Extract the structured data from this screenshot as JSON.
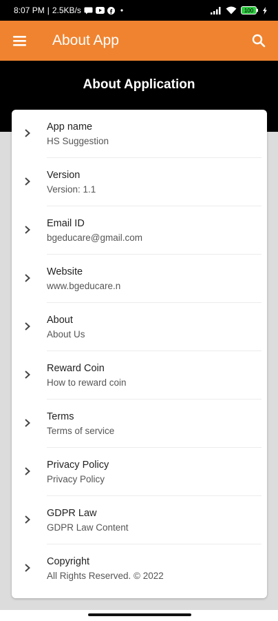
{
  "status_bar": {
    "time": "8:07 PM",
    "separator": "|",
    "speed": "2.5KB/s",
    "battery": "100"
  },
  "app_bar": {
    "title": "About App",
    "menu_icon": "hamburger-menu-icon",
    "search_icon": "search-icon"
  },
  "section": {
    "title": "About Application"
  },
  "items": [
    {
      "title": "App name",
      "subtitle": "HS Suggestion"
    },
    {
      "title": "Version",
      "subtitle": "Version: 1.1"
    },
    {
      "title": "Email ID",
      "subtitle": "bgeducare@gmail.com"
    },
    {
      "title": "Website",
      "subtitle": "www.bgeducare.n"
    },
    {
      "title": "About",
      "subtitle": "About Us"
    },
    {
      "title": "Reward Coin",
      "subtitle": "How to reward coin"
    },
    {
      "title": "Terms",
      "subtitle": "Terms of service"
    },
    {
      "title": "Privacy Policy",
      "subtitle": "Privacy Policy"
    },
    {
      "title": "GDPR Law",
      "subtitle": "GDPR Law Content"
    },
    {
      "title": "Copyright",
      "subtitle": "All Rights Reserved. © 2022"
    }
  ],
  "colors": {
    "app_bar": "#f0832f",
    "band": "#000000",
    "background": "#dcdcdc"
  }
}
